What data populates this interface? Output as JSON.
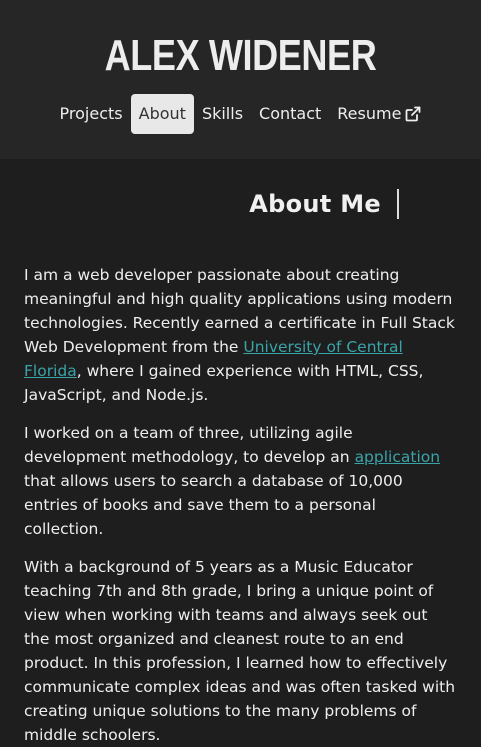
{
  "header": {
    "site_name": "ALEX WIDENER"
  },
  "nav": {
    "items": [
      {
        "label": "Projects"
      },
      {
        "label": "About"
      },
      {
        "label": "Skills"
      },
      {
        "label": "Contact"
      },
      {
        "label": "Resume",
        "icon": "external-link-icon"
      }
    ],
    "active": "About"
  },
  "about": {
    "title": "About Me",
    "p1_before": "I am a web developer passionate about creating meaningful and high quality applications using modern technologies. Recently earned a certificate in Full Stack Web Development from the ",
    "p1_link": "University of Central Florida",
    "p1_after": ", where I gained experience with HTML, CSS, JavaScript, and Node.js.",
    "p2_before": "I worked on a team of three, utilizing agile development methodology, to develop an ",
    "p2_link": "application",
    "p2_after": " that allows users to search a database of 10,000 entries of books and save them to a personal collection.",
    "p3": "With a background of 5 years as a Music Educator teaching 7th and 8th grade, I bring a unique point of view when working with teams and always seek out the most organized and cleanest route to an end product. In this profession, I learned how to effectively communicate complex ideas and was often tasked with creating unique solutions to the many problems of middle schoolers."
  },
  "colors": {
    "background": "#1e1e1e",
    "header_background": "#262626",
    "link": "#3aa3a8",
    "active_nav_background": "#e8e8e8"
  }
}
